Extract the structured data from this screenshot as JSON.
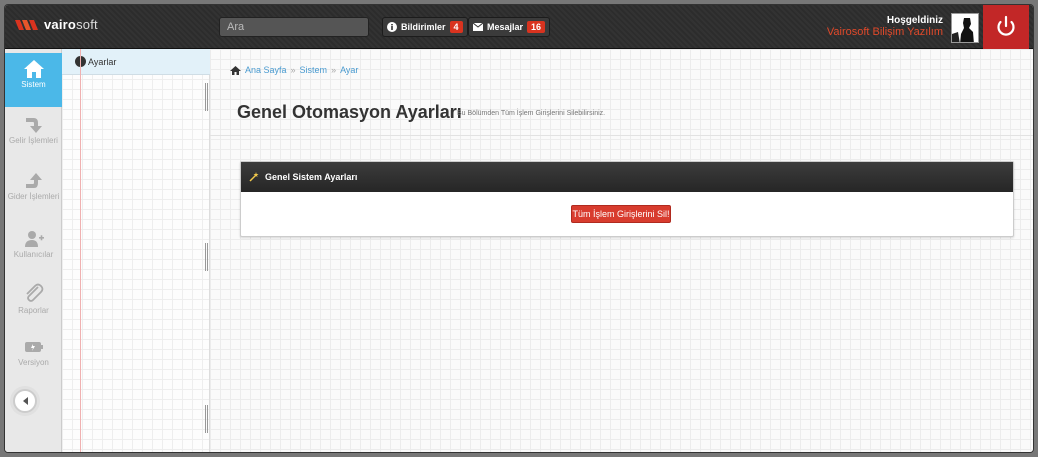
{
  "topbar": {
    "logo_bold": "vairo",
    "logo_rest": "soft",
    "search_placeholder": "Ara",
    "notifications_label": "Bildirimler",
    "notifications_count": "4",
    "messages_label": "Mesajlar",
    "messages_count": "16",
    "welcome_label": "Hoşgeldiniz",
    "user_name": "Vairosoft Bilişim Yazılım"
  },
  "sidebar": {
    "items": [
      {
        "label": "Sistem",
        "icon": "home-icon"
      },
      {
        "label": "Gelir İşlemleri",
        "icon": "arrow-down-right-icon"
      },
      {
        "label": "Gider İşlemleri",
        "icon": "arrow-up-icon"
      },
      {
        "label": "Kullanıcılar",
        "icon": "user-add-icon"
      },
      {
        "label": "Raporlar",
        "icon": "paperclip-icon"
      },
      {
        "label": "Versiyon",
        "icon": "battery-icon"
      }
    ]
  },
  "subnav": {
    "item": "Ayarlar"
  },
  "breadcrumb": [
    "Ana Sayfa",
    "Sistem",
    "Ayar"
  ],
  "main": {
    "title": "Genel Otomasyon Ayarları",
    "subtitle": "Bu Bölümden Tüm İşlem Girişlerini Silebilirsiniz.",
    "panel_title": "Genel Sistem Ayarları",
    "delete_button": "Tüm İşlem Girişlerini Sil!"
  },
  "colors": {
    "accent": "#4bb8e8",
    "danger": "#d83c2e",
    "topbar": "#2c2c2c"
  }
}
